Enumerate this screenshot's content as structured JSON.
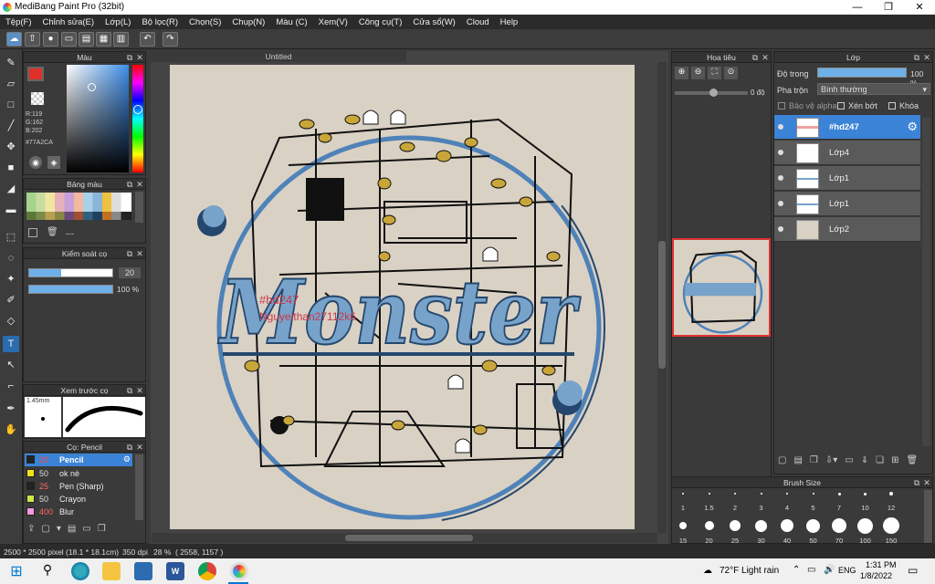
{
  "app": {
    "title": "MediBang Paint Pro (32bit)"
  },
  "menu": [
    "Tệp(F)",
    "Chỉnh sửa(E)",
    "Lớp(L)",
    "Bộ lọc(R)",
    "Chọn(S)",
    "Chụp(N)",
    "Màu (C)",
    "Xem(V)",
    "Công cụ(T)",
    "Cửa sổ(W)",
    "Cloud",
    "Help"
  ],
  "color_panel": {
    "title": "Màu",
    "r": "R:119",
    "g": "G:162",
    "b": "B:202",
    "hex": "#77A2CA",
    "current": "#e0302a"
  },
  "palette": {
    "title": "Bảng màu",
    "footer": "---"
  },
  "brush_control": {
    "title": "Kiểm soát cọ",
    "size": "20",
    "opacity": "100 %"
  },
  "brush_preview": {
    "title": "Xem trước cọ",
    "size": "1.45mm"
  },
  "brush_list": {
    "title": "Cọ: Pencil",
    "items": [
      {
        "num": "20",
        "name": "Pencil",
        "color": "#222222",
        "selected": true
      },
      {
        "num": "50",
        "name": "ok nè",
        "color": "#f2e21a"
      },
      {
        "num": "25",
        "name": "Pen (Sharp)",
        "color": "#222222"
      },
      {
        "num": "50",
        "name": "Crayon",
        "color": "#c9e84a"
      },
      {
        "num": "400",
        "name": "Blur",
        "color": "#f29adf"
      }
    ]
  },
  "document": {
    "tab": "Untitled",
    "text_overlay1": "#hd247",
    "text_overlay2": "Nguyeithan27112k6",
    "logo_text": "Monster"
  },
  "navigator": {
    "title": "Hoa tiêu",
    "angle": "0 độ"
  },
  "layers": {
    "title": "Lớp",
    "opacity_label": "Độ trong",
    "opacity_value": "100 %",
    "blend_label": "Pha trộn",
    "blend_value": "Bình thường",
    "protect_alpha": "Bảo vệ alpha",
    "clip": "Xén bớt",
    "lock": "Khóa",
    "items": [
      {
        "name": "#hd247",
        "selected": true
      },
      {
        "name": "Lớp4"
      },
      {
        "name": "Lớp1"
      },
      {
        "name": "Lớp1"
      },
      {
        "name": "Lớp2"
      }
    ]
  },
  "brush_size": {
    "title": "Brush Size",
    "row1": [
      "1",
      "1.5",
      "2",
      "3",
      "4",
      "5",
      "7",
      "10",
      "12"
    ],
    "row2": [
      "15",
      "20",
      "25",
      "30",
      "40",
      "50",
      "70",
      "100",
      "150"
    ]
  },
  "status": {
    "dims": "2500 * 2500 pixel",
    "cm": "(18.1 * 18.1cm)",
    "dpi": "350 dpi",
    "zoom": "28 %",
    "coords": "( 2558, 1157 )"
  },
  "taskbar": {
    "weather": "72°F  Light rain",
    "lang": "ENG",
    "time": "1:31 PM",
    "date": "1/8/2022"
  }
}
